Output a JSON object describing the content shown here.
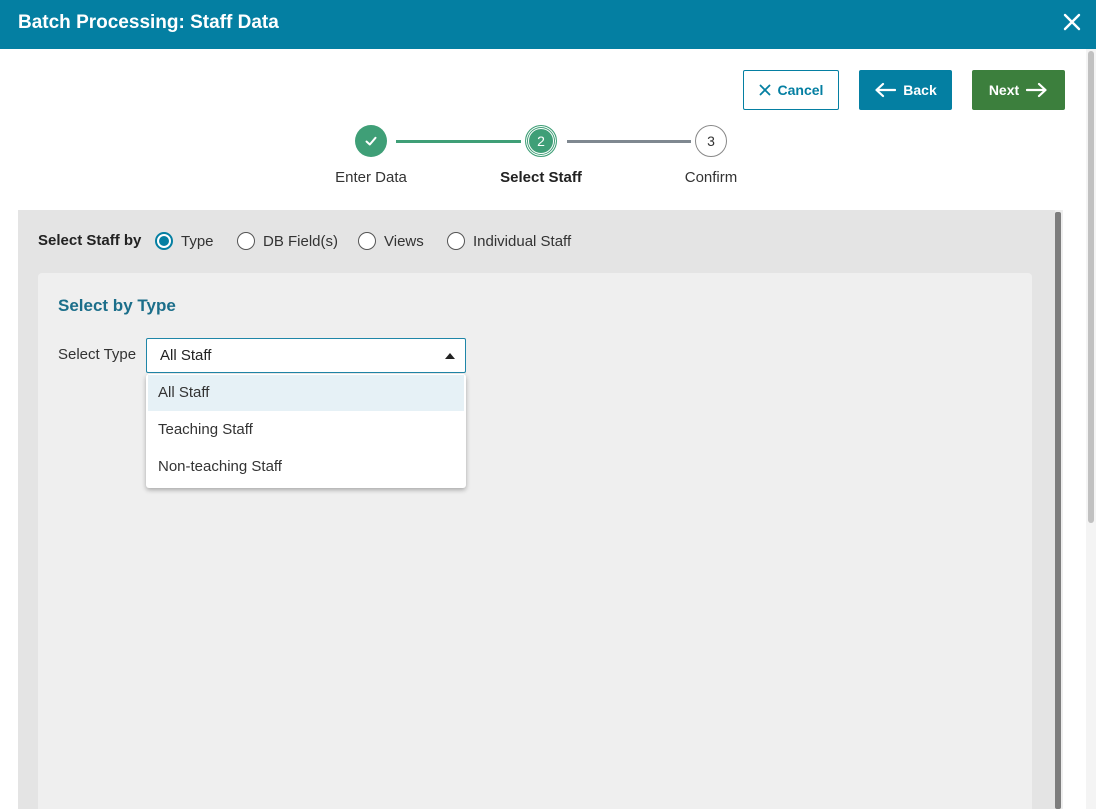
{
  "window": {
    "title": "Batch Processing: Staff Data",
    "close_icon": "close-icon"
  },
  "toolbar": {
    "cancel_label": "Cancel",
    "back_label": "Back",
    "next_label": "Next"
  },
  "steps": [
    {
      "label": "Enter Data",
      "state": "complete"
    },
    {
      "label": "Select Staff",
      "number": "2",
      "state": "active"
    },
    {
      "label": "Confirm",
      "number": "3",
      "state": "pending"
    }
  ],
  "select_by": {
    "label": "Select Staff by",
    "options": [
      {
        "label": "Type",
        "checked": true
      },
      {
        "label": "DB Field(s)",
        "checked": false
      },
      {
        "label": "Views",
        "checked": false
      },
      {
        "label": "Individual Staff",
        "checked": false
      }
    ]
  },
  "card": {
    "title": "Select by Type",
    "select_label": "Select Type",
    "select_value": "All Staff",
    "options": [
      "All Staff",
      "Teaching Staff",
      "Non-teaching Staff"
    ],
    "highlighted_option": "All Staff"
  },
  "colors": {
    "header": "#047fa2",
    "accent": "#047fa2",
    "next": "#3c7f3d",
    "step_done": "#3f9f77"
  }
}
